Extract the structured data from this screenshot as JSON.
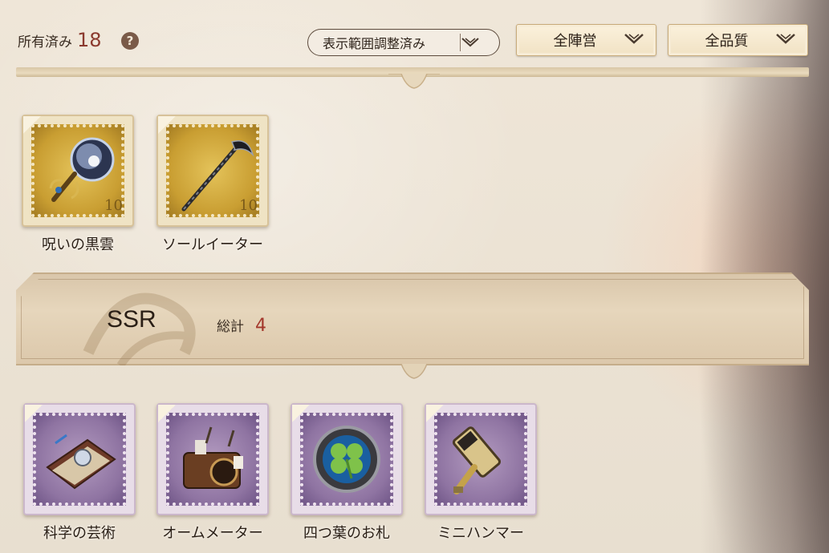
{
  "header": {
    "owned_label": "所有済み",
    "owned_count": "18",
    "help_icon": "?",
    "display_filter_label": "表示範囲調整済み",
    "faction_filter_label": "全陣営",
    "quality_filter_label": "全品質"
  },
  "owned_items": [
    {
      "name": "呪いの黒雲",
      "icon": "dark-orb-staff-icon",
      "stamp_value": "10",
      "frame": "gold"
    },
    {
      "name": "ソールイーター",
      "icon": "scythe-icon",
      "stamp_value": "10",
      "frame": "gold"
    }
  ],
  "ssr_section": {
    "title": "SSR",
    "total_label": "総計",
    "total_count": "4",
    "items": [
      {
        "name": "科学の芸術",
        "icon": "science-book-icon",
        "frame": "purple"
      },
      {
        "name": "オームメーター",
        "icon": "ohmmeter-icon",
        "frame": "purple"
      },
      {
        "name": "四つ葉のお札",
        "icon": "four-leaf-clover-icon",
        "frame": "purple"
      },
      {
        "name": "ミニハンマー",
        "icon": "mini-hammer-icon",
        "frame": "purple"
      }
    ]
  },
  "colors": {
    "accent_count": "#8b3a2e",
    "ssr_count": "#a3372b",
    "gold_stamp": "#c99e32",
    "purple_stamp": "#8f74a2"
  }
}
